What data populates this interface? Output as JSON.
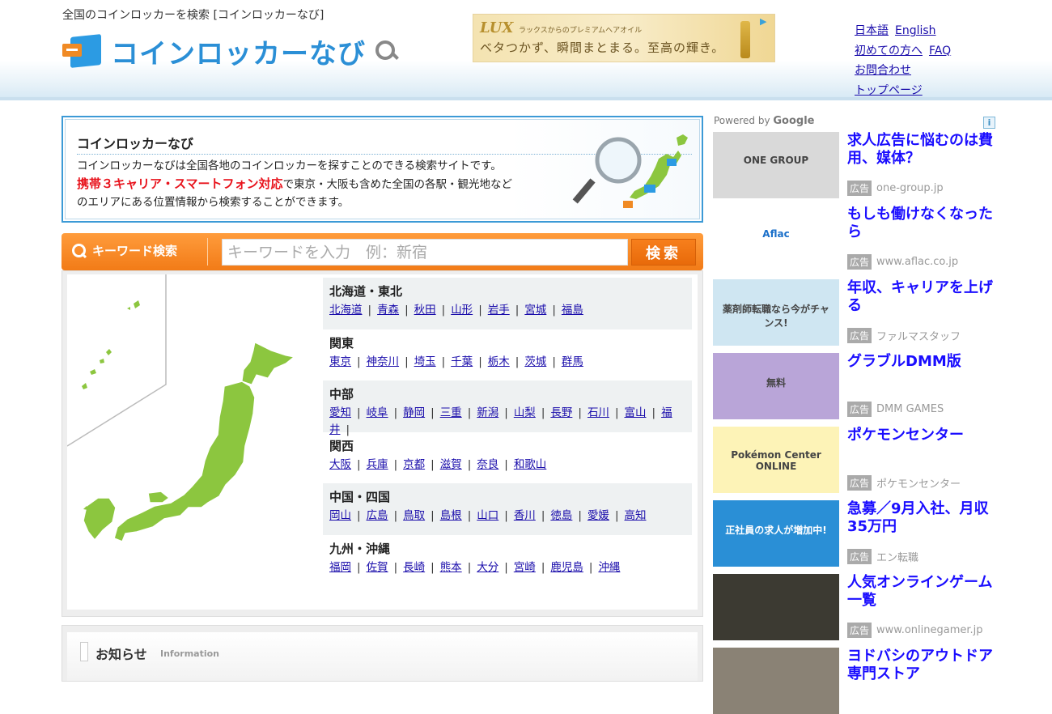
{
  "header": {
    "tagline": "全国のコインロッカーを検索 [コインロッカーなび]",
    "logo_text": "コインロッカーなび",
    "banner": {
      "brand": "LUX",
      "small": "ラックスからのプレミアムヘアオイル",
      "copy": "ベタつかず、瞬間まとまる。至高の輝き。"
    },
    "links": {
      "japanese": "日本語",
      "english": "English",
      "first_time": "初めての方へ",
      "faq": "FAQ",
      "contact": "お問合わせ",
      "top": "トップページ"
    }
  },
  "intro": {
    "title": "コインロッカーなび",
    "line1": "コインロッカーなびは全国各地のコインロッカーを探すことのできる検索サイトです。",
    "red": "携帯３キャリア・スマートフォン対応",
    "line2": "で東京・大阪も含めた全国の各駅・観光地など",
    "line3": "のエリアにある位置情報から検索することができます。"
  },
  "search": {
    "label": "キーワード検索",
    "placeholder": "キーワードを入力　例：新宿",
    "button": "検索"
  },
  "regions": [
    {
      "name": "北海道・東北",
      "prefs": [
        "北海道",
        "青森",
        "秋田",
        "山形",
        "岩手",
        "宮城",
        "福島"
      ]
    },
    {
      "name": "関東",
      "prefs": [
        "東京",
        "神奈川",
        "埼玉",
        "千葉",
        "栃木",
        "茨城",
        "群馬"
      ]
    },
    {
      "name": "中部",
      "prefs": [
        "愛知",
        "岐阜",
        "静岡",
        "三重",
        "新潟",
        "山梨",
        "長野",
        "石川",
        "富山",
        "福井"
      ]
    },
    {
      "name": "関西",
      "prefs": [
        "大阪",
        "兵庫",
        "京都",
        "滋賀",
        "奈良",
        "和歌山"
      ]
    },
    {
      "name": "中国・四国",
      "prefs": [
        "岡山",
        "広島",
        "鳥取",
        "島根",
        "山口",
        "香川",
        "徳島",
        "愛媛",
        "高知"
      ]
    },
    {
      "name": "九州・沖縄",
      "prefs": [
        "福岡",
        "佐賀",
        "長崎",
        "熊本",
        "大分",
        "宮崎",
        "鹿児島",
        "沖縄"
      ]
    }
  ],
  "news": {
    "title": "お知らせ",
    "subtitle": "Information"
  },
  "ads": {
    "powered_prefix": "Powered by",
    "powered_brand": "Google",
    "badge": "広告",
    "info_icon": "i",
    "items": [
      {
        "title": "求人広告に悩むのは費用、媒体？",
        "source": "one-group.jp",
        "image_text": "ONE GROUP",
        "color": "#d9d9d9"
      },
      {
        "title": "もしも働けなくなったら",
        "source": "www.aflac.co.jp",
        "image_text": "Aflac",
        "color": "#ffffff"
      },
      {
        "title": "年収、キャリアを上げる",
        "source": "ファルマスタッフ",
        "image_text": "薬剤師転職なら今がチャンス!",
        "color": "#cfe6f2"
      },
      {
        "title": "グラブルDMM版",
        "source": "DMM GAMES",
        "image_text": "無料",
        "color": "#b9a5d8"
      },
      {
        "title": "ポケモンセンター",
        "source": "ポケモンセンター",
        "image_text": "Pokémon Center ONLINE",
        "color": "#fdf3b7"
      },
      {
        "title": "急募／9月入社、月収35万円",
        "source": "エン転職",
        "image_text": "正社員の求人が増加中!",
        "color": "#2a8fd6"
      },
      {
        "title": "人気オンラインゲーム一覧",
        "source": "www.onlinegamer.jp",
        "image_text": "",
        "color": "#3c3a32"
      },
      {
        "title": "ヨドバシのアウトドア専門ストア",
        "source": "",
        "image_text": "",
        "color": "#8a8275"
      }
    ]
  }
}
